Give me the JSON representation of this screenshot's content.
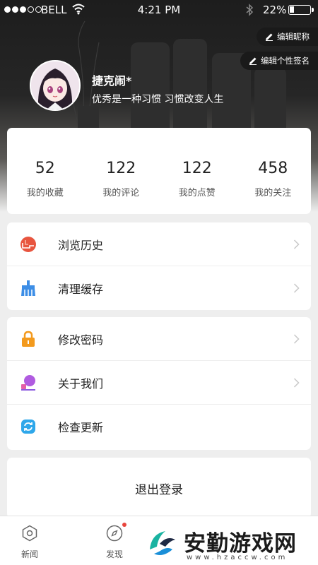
{
  "status_bar": {
    "carrier": "BELL",
    "time": "4:21 PM",
    "battery_percent": "22%",
    "battery_level": 0.22,
    "signal_bars_filled": 3,
    "signal_bars_total": 5
  },
  "header": {
    "edit_nickname_label": "编辑昵称",
    "edit_signature_label": "编辑个性签名"
  },
  "profile": {
    "username": "捷克闹*",
    "signature": "优秀是一种习惯 习惯改变人生"
  },
  "stats": [
    {
      "value": "52",
      "label": "我的收藏"
    },
    {
      "value": "122",
      "label": "我的评论"
    },
    {
      "value": "122",
      "label": "我的点赞"
    },
    {
      "value": "458",
      "label": "我的关注"
    }
  ],
  "menu_group_1": [
    {
      "label": "浏览历史",
      "icon": "history-icon"
    },
    {
      "label": "清理缓存",
      "icon": "broom-icon"
    }
  ],
  "menu_group_2": [
    {
      "label": "修改密码",
      "icon": "lock-icon"
    },
    {
      "label": "关于我们",
      "icon": "about-icon"
    },
    {
      "label": "检查更新",
      "icon": "refresh-icon"
    }
  ],
  "logout_label": "退出登录",
  "tabs": [
    {
      "label": "新闻",
      "icon": "hexagon-icon"
    },
    {
      "label": "发现",
      "icon": "compass-icon"
    }
  ],
  "watermark": {
    "text": "安勤游戏网",
    "url": "www.hzaccw.com"
  },
  "colors": {
    "header_dark": "#1d1d1d",
    "history_icon": "#e8553f",
    "broom_icon": "#3d8ee6",
    "lock_icon": "#f39a1d",
    "about_icon": "#b05be0",
    "refresh_icon": "#2ea7ea",
    "badge": "#e8453c"
  }
}
